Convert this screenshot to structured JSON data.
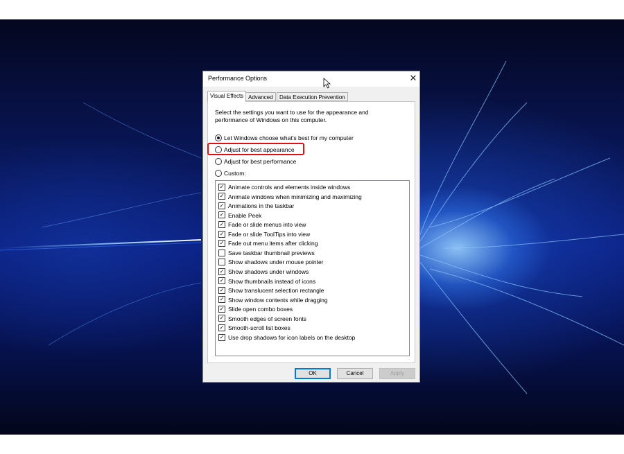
{
  "dialog": {
    "title": "Performance Options",
    "close_glyph": "✕"
  },
  "tabs": [
    {
      "label": "Visual Effects",
      "active": true
    },
    {
      "label": "Advanced",
      "active": false
    },
    {
      "label": "Data Execution Prevention",
      "active": false
    }
  ],
  "visual_effects": {
    "description": "Select the settings you want to use for the appearance and performance of Windows on this computer.",
    "options": [
      {
        "label": "Let Windows choose what's best for my computer",
        "selected": true
      },
      {
        "label": "Adjust for best appearance",
        "selected": false
      },
      {
        "label": "Adjust for best performance",
        "selected": false
      },
      {
        "label": "Custom:",
        "selected": false
      }
    ],
    "effects": [
      {
        "label": "Animate controls and elements inside windows",
        "checked": true
      },
      {
        "label": "Animate windows when minimizing and maximizing",
        "checked": true
      },
      {
        "label": "Animations in the taskbar",
        "checked": true
      },
      {
        "label": "Enable Peek",
        "checked": true
      },
      {
        "label": "Fade or slide menus into view",
        "checked": true
      },
      {
        "label": "Fade or slide ToolTips into view",
        "checked": true
      },
      {
        "label": "Fade out menu items after clicking",
        "checked": true
      },
      {
        "label": "Save taskbar thumbnail previews",
        "checked": false
      },
      {
        "label": "Show shadows under mouse pointer",
        "checked": false
      },
      {
        "label": "Show shadows under windows",
        "checked": true
      },
      {
        "label": "Show thumbnails instead of icons",
        "checked": true
      },
      {
        "label": "Show translucent selection rectangle",
        "checked": true
      },
      {
        "label": "Show window contents while dragging",
        "checked": true
      },
      {
        "label": "Slide open combo boxes",
        "checked": true
      },
      {
        "label": "Smooth edges of screen fonts",
        "checked": true
      },
      {
        "label": "Smooth-scroll list boxes",
        "checked": true
      },
      {
        "label": "Use drop shadows for icon labels on the desktop",
        "checked": true
      }
    ]
  },
  "buttons": {
    "ok": "OK",
    "cancel": "Cancel",
    "apply": "Apply"
  },
  "colors": {
    "highlight": "#e01010",
    "default_button_border": "#0078d7"
  }
}
